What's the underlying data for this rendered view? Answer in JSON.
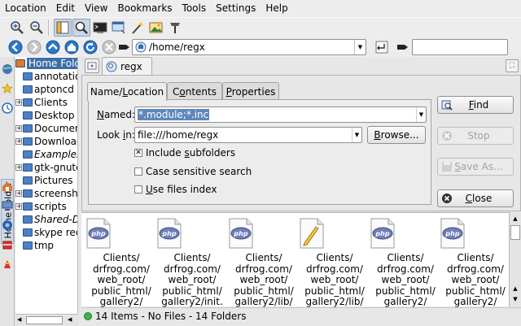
{
  "menubar": {
    "items": [
      "Location",
      "Edit",
      "View",
      "Bookmarks",
      "Tools",
      "Settings",
      "Help"
    ]
  },
  "location": {
    "value": "/home/regx"
  },
  "colors": {
    "selection": "#3d6ea7",
    "named_highlight": "#5e87bd",
    "status_ok": "#3fb34a"
  },
  "sidebar": {
    "vertical_tab_label": "Home Folder"
  },
  "tree": {
    "items": [
      {
        "label": "Home Folde",
        "selected": true,
        "expandable": false,
        "indent": 0
      },
      {
        "label": "annotatio",
        "expandable": false,
        "indent": 1
      },
      {
        "label": "aptoncd",
        "expandable": false,
        "indent": 1
      },
      {
        "label": "Clients",
        "expandable": true,
        "indent": 1
      },
      {
        "label": "Desktop",
        "expandable": false,
        "indent": 1
      },
      {
        "label": "Documen",
        "expandable": true,
        "indent": 1
      },
      {
        "label": "Downloac",
        "expandable": true,
        "indent": 1
      },
      {
        "label": "Examples",
        "expandable": false,
        "indent": 1,
        "italic": true
      },
      {
        "label": "gtk-gnute",
        "expandable": true,
        "indent": 1
      },
      {
        "label": "Pictures",
        "expandable": false,
        "indent": 1
      },
      {
        "label": "screensh",
        "expandable": true,
        "indent": 1
      },
      {
        "label": "scripts",
        "expandable": true,
        "indent": 1
      },
      {
        "label": "Shared-D",
        "expandable": false,
        "indent": 1,
        "italic": true
      },
      {
        "label": "skype rec",
        "expandable": false,
        "indent": 1
      },
      {
        "label": "tmp",
        "expandable": false,
        "indent": 1
      }
    ]
  },
  "tab": {
    "label": "regx"
  },
  "find": {
    "tabs": [
      "Name/Location",
      "Contents",
      "Properties"
    ],
    "named_label": "Named:",
    "named_value": "*.module;*.inc",
    "lookin_label": "Look in:",
    "lookin_value": "file:///home/regx",
    "browse_label": "Browse...",
    "include_subfolders": {
      "label": "Include subfolders",
      "checked": true
    },
    "case_sensitive": {
      "label": "Case sensitive search",
      "checked": false
    },
    "use_index": {
      "label": "Use files index",
      "checked": false
    },
    "buttons": {
      "find": "Find",
      "stop": "Stop",
      "save_as": "Save As...",
      "close": "Close"
    }
  },
  "results": {
    "items": [
      {
        "name": "Clients/\ndrfrog.com/\nweb_root/\npublic_html/\ngallery2/",
        "icon": "php-file-icon"
      },
      {
        "name": "Clients/\ndrfrog.com/\nweb_root/\npublic_html/\ngallery2/init.",
        "icon": "php-file-icon"
      },
      {
        "name": "Clients/\ndrfrog.com/\nweb_root/\npublic_html/\ngallery2/lib/",
        "icon": "php-file-icon"
      },
      {
        "name": "Clients/\ndrfrog.com/\nweb_root/\npublic_html/\ngallery2/lib/",
        "icon": "text-file-icon"
      },
      {
        "name": "Clients/\ndrfrog.com/\nweb_root/\npublic_html/\ngallery2/",
        "icon": "php-file-icon"
      },
      {
        "name": "Clients/\ndrfrog.com/\nweb_root/\npublic_html/\ngallery2/",
        "icon": "php-file-icon"
      }
    ]
  },
  "status": {
    "text": "14 Items - No Files - 14 Folders"
  }
}
